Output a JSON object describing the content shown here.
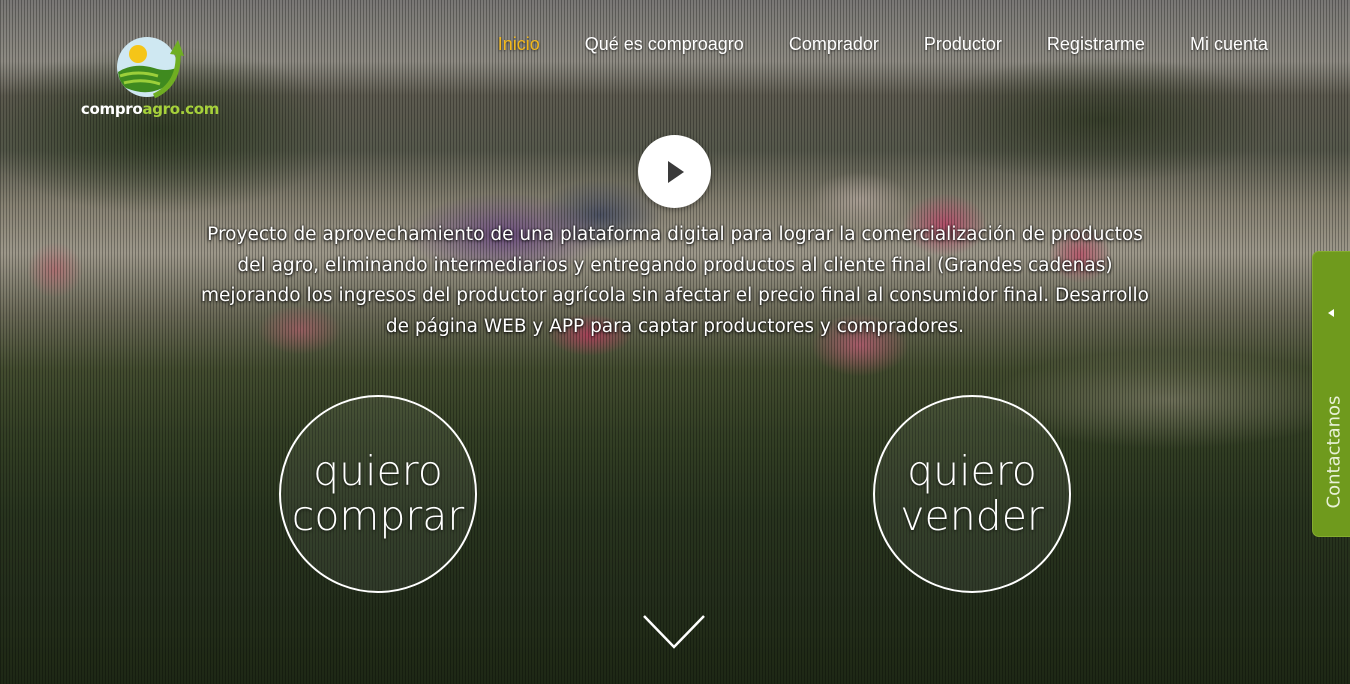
{
  "brand": {
    "name_part1": "compro",
    "name_part2": "agro.com",
    "logo_icon": "field-sun-arrow-logo",
    "accent_color": "#a6d13b"
  },
  "nav": {
    "items": [
      {
        "label": "Inicio",
        "active": true
      },
      {
        "label": "Qué es comproagro",
        "active": false
      },
      {
        "label": "Comprador",
        "active": false
      },
      {
        "label": "Productor",
        "active": false
      },
      {
        "label": "Registrarme",
        "active": false
      },
      {
        "label": "Mi cuenta",
        "active": false
      }
    ],
    "active_color": "#f2b81c"
  },
  "hero": {
    "play_icon": "play-icon",
    "description": "Proyecto de aprovechamiento de una plataforma digital para lograr la comercialización de productos del agro, eliminando intermediarios y entregando productos al cliente final (Grandes cadenas) mejorando los ingresos del productor agrícola sin afectar el precio final al consumidor final. Desarrollo de página WEB y APP para captar productores y compradores.",
    "buy": {
      "line1": "quiero",
      "line2": "comprar"
    },
    "sell": {
      "line1": "quiero",
      "line2": "vender"
    },
    "scroll_icon": "chevron-down-icon"
  },
  "contact_tab": {
    "label": "Contactanos",
    "color": "#6f9a1d"
  }
}
